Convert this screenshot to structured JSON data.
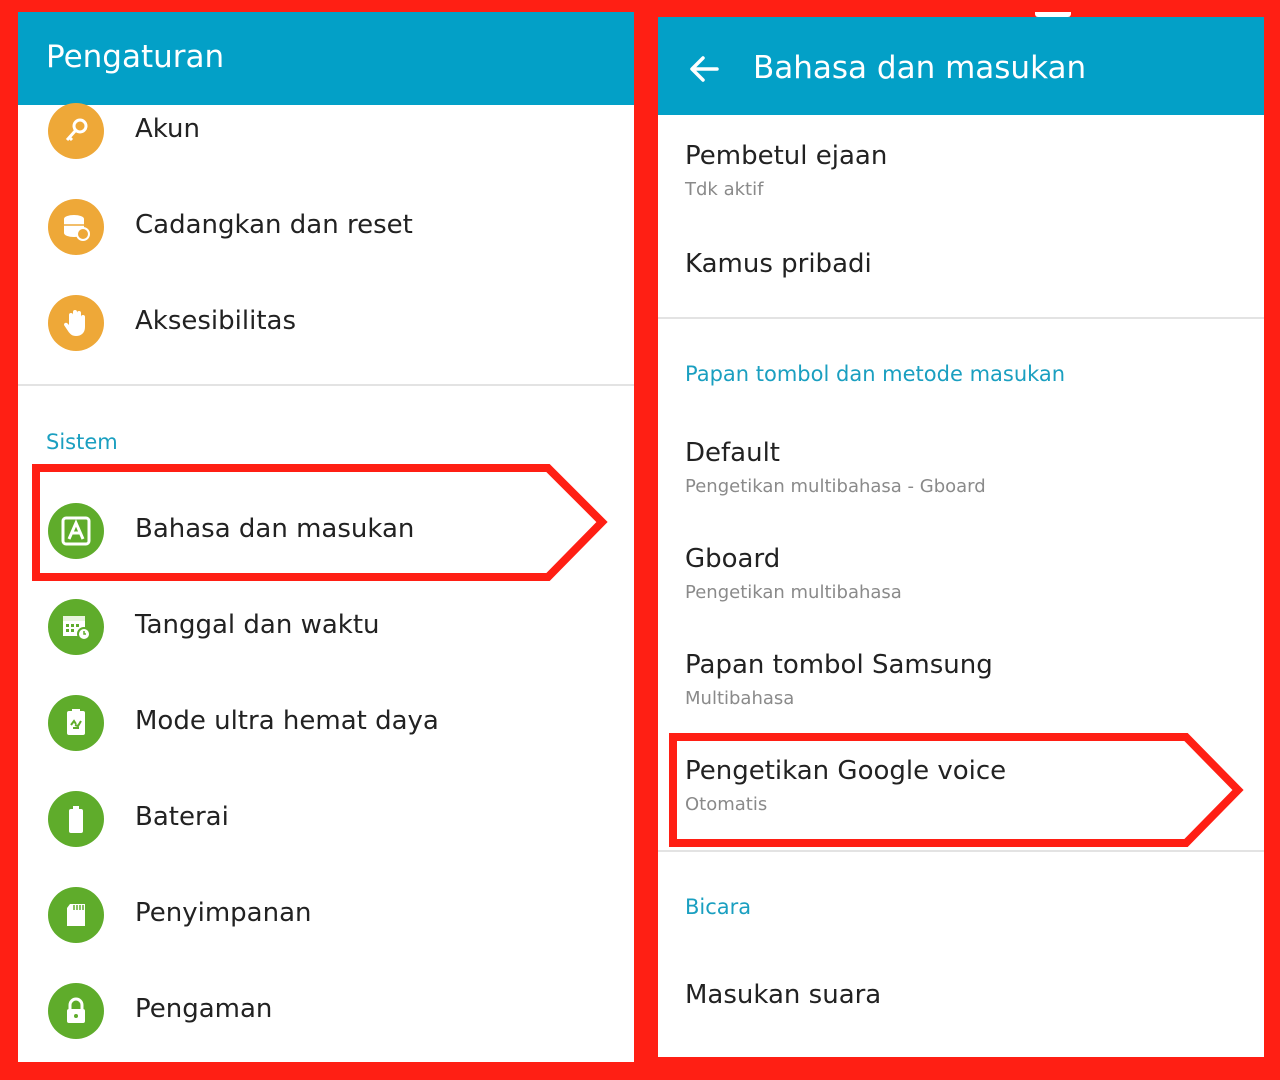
{
  "left": {
    "appbar_title": "Pengaturan",
    "items_top": [
      {
        "label": "Akun",
        "icon": "key-icon"
      },
      {
        "label": "Cadangkan dan reset",
        "icon": "backup-reset-icon"
      },
      {
        "label": "Aksesibilitas",
        "icon": "hand-icon"
      }
    ],
    "section_label": "Sistem",
    "items_system": [
      {
        "label": "Bahasa dan masukan",
        "icon": "language-icon"
      },
      {
        "label": "Tanggal dan waktu",
        "icon": "calendar-clock-icon"
      },
      {
        "label": "Mode ultra hemat daya",
        "icon": "power-saving-icon"
      },
      {
        "label": "Baterai",
        "icon": "battery-icon"
      },
      {
        "label": "Penyimpanan",
        "icon": "sd-card-icon"
      },
      {
        "label": "Pengaman",
        "icon": "lock-icon"
      }
    ]
  },
  "right": {
    "appbar_title": "Bahasa dan masukan",
    "items_top": [
      {
        "title": "Pembetul ejaan",
        "summary": "Tdk aktif"
      },
      {
        "title": "Kamus pribadi"
      }
    ],
    "section_keyboard": "Papan tombol dan metode masukan",
    "keyboard_items": [
      {
        "title": "Default",
        "summary": "Pengetikan multibahasa - Gboard"
      },
      {
        "title": "Gboard",
        "summary": "Pengetikan multibahasa"
      },
      {
        "title": "Papan tombol Samsung",
        "summary": "Multibahasa"
      },
      {
        "title": "Pengetikan Google voice",
        "summary": "Otomatis"
      }
    ],
    "section_speech": "Bicara",
    "speech_items": [
      {
        "title": "Masukan suara"
      }
    ]
  },
  "colors": {
    "appbar": "#03a0c7",
    "frame": "#ff1f14",
    "section_header": "#1a9fc0",
    "icon_orange": "#eea838",
    "icon_green": "#5fac2b"
  }
}
